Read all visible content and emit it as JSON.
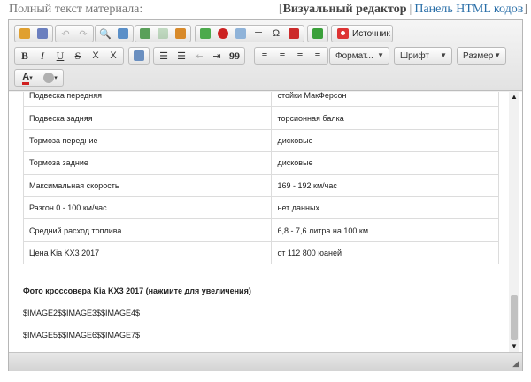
{
  "header": {
    "field_label": "Полный текст материала:",
    "mode_active": "Визуальный редактор",
    "mode_link": "Панель HTML кодов",
    "bracket_open": "[",
    "bracket_close": "]",
    "separator": "|"
  },
  "toolbar": {
    "source_label": "Источник",
    "combos": {
      "format": "Формат...",
      "font": "Шрифт",
      "size": "Размер"
    },
    "buttons": {
      "bold": "B",
      "italic": "I",
      "underline": "U",
      "strike": "S",
      "subscript": "X",
      "superscript": "X",
      "quote": "99",
      "font_color": "A"
    }
  },
  "spec_table": [
    {
      "name": "Подвеска передняя",
      "value": "стойки МакФерсон"
    },
    {
      "name": "Подвеска задняя",
      "value": "торсионная балка"
    },
    {
      "name": "Тормоза передние",
      "value": "дисковые"
    },
    {
      "name": "Тормоза задние",
      "value": "дисковые"
    },
    {
      "name": "Максимальная скорость",
      "value": "169 - 192 км/час"
    },
    {
      "name": "Разгон 0 - 100 км/час",
      "value": "нет данных"
    },
    {
      "name": "Средний расход топлива",
      "value": "6,8 - 7,6 литра на 100 км"
    },
    {
      "name": "Цена Kia KX3 2017",
      "value": "от 112 800 юаней"
    }
  ],
  "paragraphs": {
    "photo_heading": "Фото кроссовера Kia KX3 2017 (нажмите для увеличения)",
    "images_line1": "$IMAGE2$$IMAGE3$$IMAGE4$",
    "images_line2": "$IMAGE5$$IMAGE6$$IMAGE7$"
  }
}
